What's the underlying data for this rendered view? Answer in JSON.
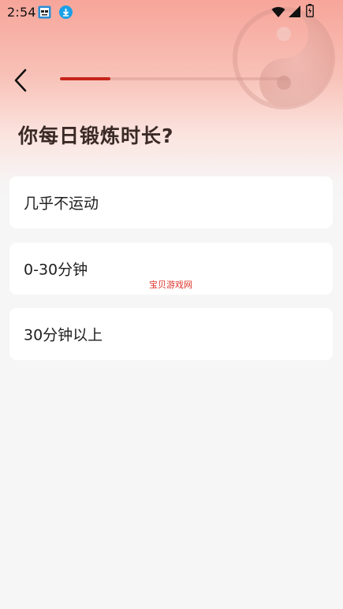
{
  "status_bar": {
    "time": "2:54",
    "icons": [
      "app-notification-icon",
      "download-icon",
      "wifi-icon",
      "signal-icon",
      "battery-icon"
    ]
  },
  "header": {
    "back_icon": "chevron-left-icon",
    "progress_fraction": 0.22
  },
  "question": {
    "title": "你每日锻炼时长?"
  },
  "options": [
    {
      "label": "几乎不运动"
    },
    {
      "label": "0-30分钟"
    },
    {
      "label": "30分钟以上"
    }
  ],
  "watermark": "宝贝游戏网",
  "colors": {
    "accent": "#c7251b",
    "header_top": "#f7a59a",
    "background": "#f6f6f7",
    "card": "#ffffff",
    "title_text": "#3a2a26",
    "watermark": "#e0352a"
  }
}
